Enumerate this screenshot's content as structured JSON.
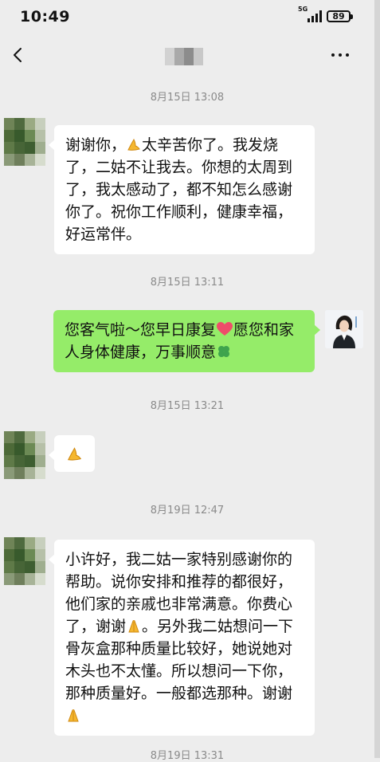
{
  "status_bar": {
    "time": "10:49",
    "network": "5G",
    "battery": "89"
  },
  "nav": {
    "back_icon": "chevron-left-icon",
    "more_icon": "more-dots-icon"
  },
  "messages": [
    {
      "type": "time",
      "text": "8月15日 13:08"
    },
    {
      "type": "msg",
      "side": "left",
      "lines": [
        "谢谢你，",
        "太辛苦你了。我发烧",
        "了，二姑不让我去。你想的太周到",
        "了，我太感动了，都不知怎么感谢",
        "你了。祝你工作顺利，健康幸福，",
        "好运常伴。"
      ]
    },
    {
      "type": "time",
      "text": "8月15日 13:11"
    },
    {
      "type": "msg",
      "side": "right",
      "lines": [
        "您客气啦～您早日康复",
        "愿您和家",
        "人身体健康，万事顺意"
      ]
    },
    {
      "type": "time",
      "text": "8月15日 13:21"
    },
    {
      "type": "msg",
      "side": "left",
      "emoji_only": "pray-hands-emoji"
    },
    {
      "type": "time",
      "text": "8月19日 12:47"
    },
    {
      "type": "msg",
      "side": "left",
      "lines": [
        "小许好，我二姑一家特别感谢你的",
        "帮助。说你安排和推荐的都很好，",
        "他们家的亲戚也非常满意。你费心",
        "了，谢谢",
        "。另外我二姑想问一下",
        "骨灰盒那种质量比较好，她说她对",
        "木头也不太懂。所以想问一下你，",
        "那种质量好。一般都选那种。谢谢"
      ]
    },
    {
      "type": "time",
      "text": "8月19日 13:31"
    }
  ],
  "colors": {
    "background": "#ededed",
    "bubble_self": "#95ec69",
    "bubble_other": "#ffffff",
    "timestamp": "#8a8a8a"
  }
}
